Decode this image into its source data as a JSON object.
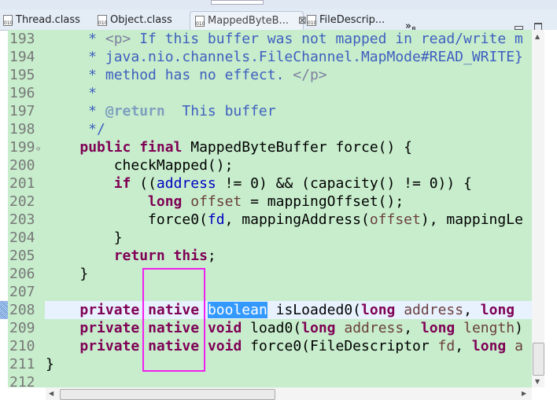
{
  "tabs": [
    {
      "label": "Thread.class",
      "icon": "class-file-icon"
    },
    {
      "label": "Object.class",
      "icon": "class-file-icon"
    },
    {
      "label": "MappedByteB...",
      "icon": "class-file-icon",
      "active": true
    },
    {
      "label": "FileDescrip...",
      "icon": "class-file-icon"
    }
  ],
  "more_tabs": {
    "glyph": "»",
    "count": "8"
  },
  "colors": {
    "background": "#c7edcc",
    "keyword": "#7f0055",
    "javadoc": "#3f5fbf",
    "highlight_box": "#f020f0",
    "selection": "#3399ff"
  },
  "current_line": "208",
  "lines": [
    {
      "n": "193",
      "t": [
        [
          "     * ",
          "jd"
        ],
        [
          "<p>",
          "tag"
        ],
        [
          " If this buffer was not mapped in read/write m",
          "jd"
        ]
      ]
    },
    {
      "n": "194",
      "t": [
        [
          "     * java.nio.channels.FileChannel.MapMode#READ_WRITE}",
          "jd"
        ]
      ]
    },
    {
      "n": "195",
      "t": [
        [
          "     * method has no effect. ",
          "jd"
        ],
        [
          "</p>",
          "tag"
        ]
      ]
    },
    {
      "n": "196",
      "t": [
        [
          "     *",
          "jd"
        ]
      ]
    },
    {
      "n": "197",
      "t": [
        [
          "     * ",
          "jd"
        ],
        [
          "@return",
          "ann"
        ],
        [
          "  This buffer",
          "jd"
        ]
      ]
    },
    {
      "n": "198",
      "t": [
        [
          "     */",
          "jd"
        ]
      ]
    },
    {
      "n": "199",
      "t": [
        [
          "    ",
          "plain"
        ],
        [
          "public final",
          "kw"
        ],
        [
          " MappedByteBuffer force() {",
          "plain"
        ]
      ]
    },
    {
      "n": "200",
      "t": [
        [
          "        checkMapped();",
          "plain"
        ]
      ]
    },
    {
      "n": "201",
      "t": [
        [
          "        ",
          "plain"
        ],
        [
          "if",
          "kw"
        ],
        [
          " ((",
          "plain"
        ],
        [
          "address",
          "fld"
        ],
        [
          " != 0) && (capacity() != 0)) {",
          "plain"
        ]
      ]
    },
    {
      "n": "202",
      "t": [
        [
          "            ",
          "plain"
        ],
        [
          "long",
          "kw"
        ],
        [
          " ",
          "plain"
        ],
        [
          "offset",
          "var"
        ],
        [
          " = mappingOffset();",
          "plain"
        ]
      ]
    },
    {
      "n": "203",
      "t": [
        [
          "            force0(",
          "plain"
        ],
        [
          "fd",
          "fld"
        ],
        [
          ", mappingAddress(",
          "plain"
        ],
        [
          "offset",
          "var"
        ],
        [
          "), mappingLe",
          "plain"
        ]
      ]
    },
    {
      "n": "204",
      "t": [
        [
          "        }",
          "plain"
        ]
      ]
    },
    {
      "n": "205",
      "t": [
        [
          "        ",
          "plain"
        ],
        [
          "return this",
          "kw"
        ],
        [
          ";",
          "plain"
        ]
      ]
    },
    {
      "n": "206",
      "t": [
        [
          "    }",
          "plain"
        ]
      ]
    },
    {
      "n": "207",
      "t": []
    },
    {
      "n": "208",
      "t": [
        [
          "    ",
          "plain"
        ],
        [
          "private",
          "kw"
        ],
        [
          " ",
          "plain"
        ],
        [
          "native",
          "kw"
        ],
        [
          " ",
          "plain"
        ],
        [
          "boolean",
          "sel"
        ],
        [
          " isLoaded0(",
          "plain"
        ],
        [
          "long",
          "kw"
        ],
        [
          " ",
          "plain"
        ],
        [
          "address",
          "var"
        ],
        [
          ", ",
          "plain"
        ],
        [
          "long",
          "kw"
        ]
      ]
    },
    {
      "n": "209",
      "t": [
        [
          "    ",
          "plain"
        ],
        [
          "private",
          "kw"
        ],
        [
          " ",
          "plain"
        ],
        [
          "native",
          "kw"
        ],
        [
          " ",
          "plain"
        ],
        [
          "void",
          "kw"
        ],
        [
          " load0(",
          "plain"
        ],
        [
          "long",
          "kw"
        ],
        [
          " ",
          "plain"
        ],
        [
          "address",
          "var"
        ],
        [
          ", ",
          "plain"
        ],
        [
          "long",
          "kw"
        ],
        [
          " ",
          "plain"
        ],
        [
          "length",
          "var"
        ],
        [
          ")",
          "plain"
        ]
      ]
    },
    {
      "n": "210",
      "t": [
        [
          "    ",
          "plain"
        ],
        [
          "private",
          "kw"
        ],
        [
          " ",
          "plain"
        ],
        [
          "native",
          "kw"
        ],
        [
          " ",
          "plain"
        ],
        [
          "void",
          "kw"
        ],
        [
          " force0(FileDescriptor ",
          "plain"
        ],
        [
          "fd",
          "var"
        ],
        [
          ", ",
          "plain"
        ],
        [
          "long",
          "kw"
        ],
        [
          " a",
          "var"
        ]
      ]
    },
    {
      "n": "211",
      "t": [
        [
          "}",
          "plain"
        ]
      ]
    },
    {
      "n": "212",
      "t": []
    }
  ]
}
